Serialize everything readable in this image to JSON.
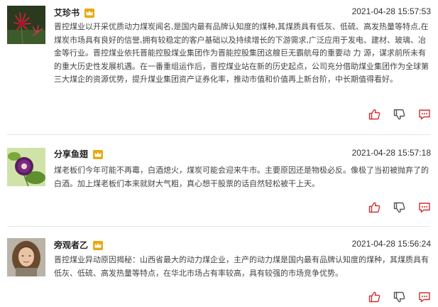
{
  "colors": {
    "accent_red": "#d32f2f",
    "vip_gold": "#e8a911",
    "divider": "#e6e6e6"
  },
  "comments": [
    {
      "username": "艾珍书",
      "badge_icon": "vip-crown-icon",
      "time": "2021-04-28 15:57:53",
      "text": "晋控煤业以开采优质动力煤炭闻名,是国内最有品牌认知度的煤种,其煤质具有低灰、低硫、高发热量等特点,在煤炭市场具有良好的信誉,拥有较稳定的客户基础以及持续增长的下游需求,广泛应用于发电、建材、玻璃、冶金等行业。晋控煤业依托晋能控股煤业集团作为晋能控股集团这艘巨无霸航母的重要动 力 源，谋求前所未有的重大历史性发展机遇。在一番重组运作后，晋控煤业站在新的历史起点，公司充分借助煤业集团作为全球第三大煤企的资源优势，提升煤业集团资产证券化率，推动市值和价值再上新台阶，中长期值得看好。",
      "avatar": "red-flower"
    },
    {
      "username": "分享鱼翅",
      "badge_icon": "vip-crown-icon",
      "time": "2021-04-28 15:57:18",
      "text": "煤老板们今年可能不再霉，白酒熄火，煤炭可能会迎来牛市。主要原因还是物极必反。像极了当初被抛弃了的白酒。加上煤老板们本来就财大气粗，真心想干股票的话自然轻松被干上天。",
      "avatar": "purple-flower"
    },
    {
      "username": "旁观者乙",
      "badge_icon": "vip-crown-icon",
      "time": "2021-04-28 15:56:24",
      "text": "晋控煤业异动原因揭秘：山西省最大的动力煤企业，主产的动力煤是国内最有品牌认知度的煤种，其煤质具有低灰、低硫、高发热量等特点，在华北市场占有率较高，具有较强的市场竞争优势。",
      "avatar": "woman-portrait"
    }
  ],
  "action_icons": [
    "thumbs-up-icon",
    "thumbs-down-icon",
    "comment-icon"
  ]
}
